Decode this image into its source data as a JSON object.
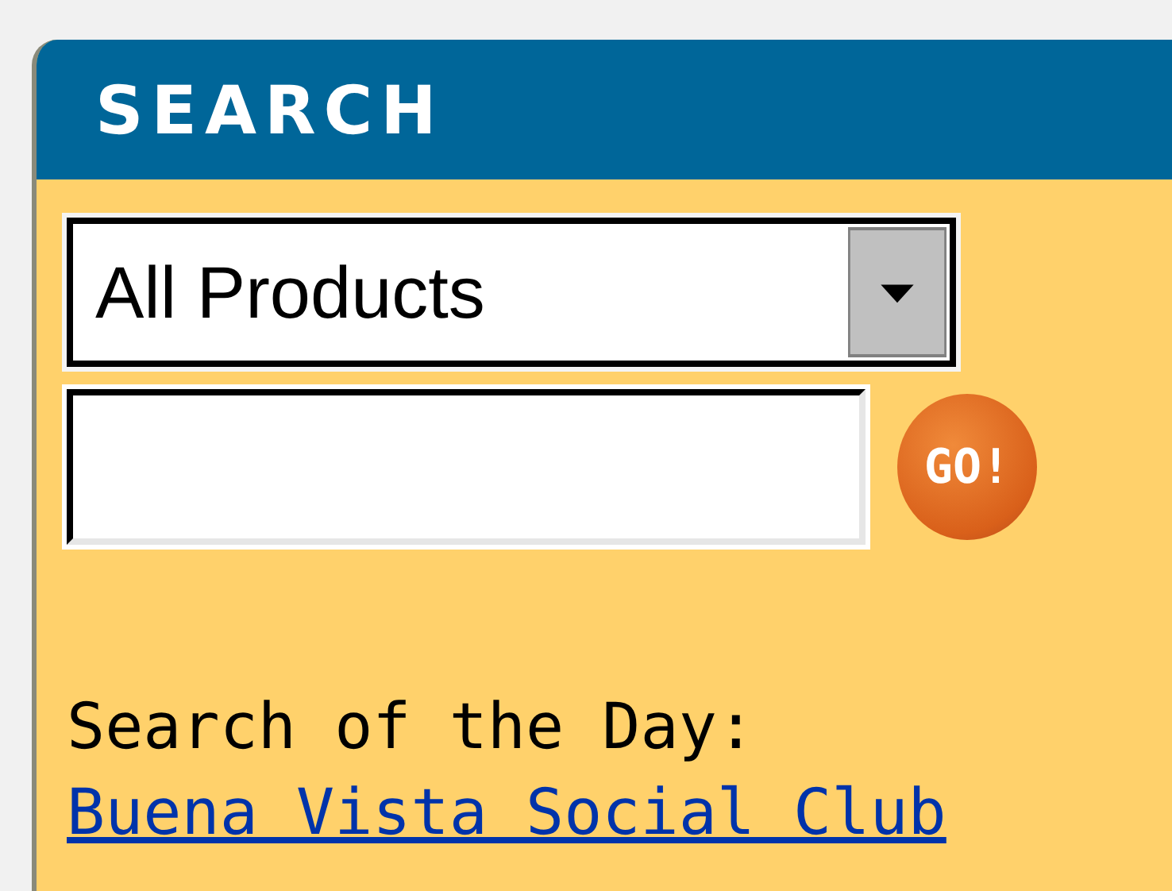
{
  "panel": {
    "title": "SEARCH"
  },
  "category_select": {
    "value": "All Products"
  },
  "go_button": {
    "label": "GO!"
  },
  "search_of_the_day": {
    "label": "Search of the Day:",
    "link": "Buena Vista Social Club"
  }
}
